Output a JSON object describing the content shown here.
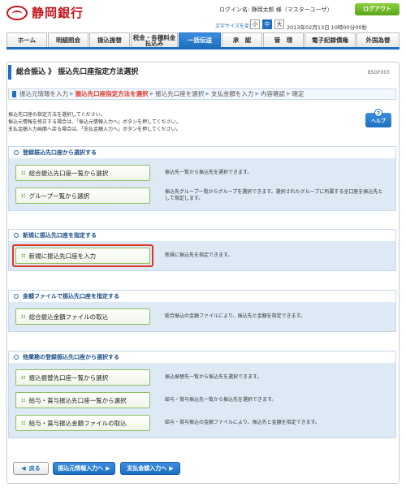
{
  "header": {
    "bank_name": "静岡銀行",
    "login_name": "ログイン名: 静岡太郎 様（マスターユーザ）",
    "logout_label": "ログアウト",
    "font_size_label": "文字サイズを変更",
    "font_sizes": [
      "小",
      "中",
      "大"
    ],
    "datetime": "2013年02月13日 10時00分00秒"
  },
  "nav": {
    "items": [
      "ホーム",
      "明細照会",
      "振込振替",
      "税金・各種料金払込み",
      "一括伝送",
      "承　認",
      "管　理",
      "電子記録債権",
      "外国為替"
    ],
    "active_index": 4
  },
  "page": {
    "title": "総合振込 》 振込先口座指定方法選択",
    "screen_id": "BSGF003",
    "steps": [
      "振込元情報を入力",
      "振込先口座指定方法を選択",
      "振込先口座を選択",
      "支払金額を入力",
      "内容確認",
      "確定"
    ],
    "current_step": 1,
    "intro": [
      "振込先口座の指定方法を選択してください。",
      "振込元情報を修正する場合は、「振込元情報入力へ」ボタンを押してください。",
      "支払金額入力画面へ戻る場合は、「支払金額入力へ」ボタンを押してください。"
    ],
    "help_label": "ヘルプ"
  },
  "sections": [
    {
      "title": "登録振込先口座から選択する",
      "options": [
        {
          "label": "総合振込先口座一覧から選択",
          "desc": "振込先一覧から振込先を選択できます。"
        },
        {
          "label": "グループ一覧から選択",
          "desc": "振込先グループ一覧からグループを選択できます。選択されたグループに所属する全口座を振込先として指定します。"
        }
      ]
    },
    {
      "title": "新規に振込先口座を指定する",
      "options": [
        {
          "label": "新規に振込先口座を入力",
          "desc": "新規に振込先を指定できます。"
        }
      ]
    },
    {
      "title": "金額ファイルで振込先口座を指定する",
      "options": [
        {
          "label": "総合振込金額ファイルの取込",
          "desc": "総合振込の金額ファイルにより、振込先と金額を指定できます。"
        }
      ]
    },
    {
      "title": "他業務の登録振込先口座から選択する",
      "options": [
        {
          "label": "振込振替先口座一覧から選択",
          "desc": "振込振替先一覧から振込先を選択できます。"
        },
        {
          "label": "給与・賞与振込先口座一覧から選択",
          "desc": "給与・賞与振込先一覧から振込先を選択できます。"
        },
        {
          "label": "給与・賞与振込金額ファイルの取込",
          "desc": "給与・賞与振込の金額ファイルにより、振込先と金額を指定できます。"
        }
      ]
    }
  ],
  "footer": {
    "back_label": "戻る",
    "source_info_label": "振込元情報入力へ",
    "payment_amount_label": "支払金額入力へ"
  },
  "colors": {
    "brand_red": "#c4161c",
    "primary_blue": "#1d6fc0",
    "highlight_red": "#e0342a",
    "section_bg": "#ddeaf6"
  }
}
